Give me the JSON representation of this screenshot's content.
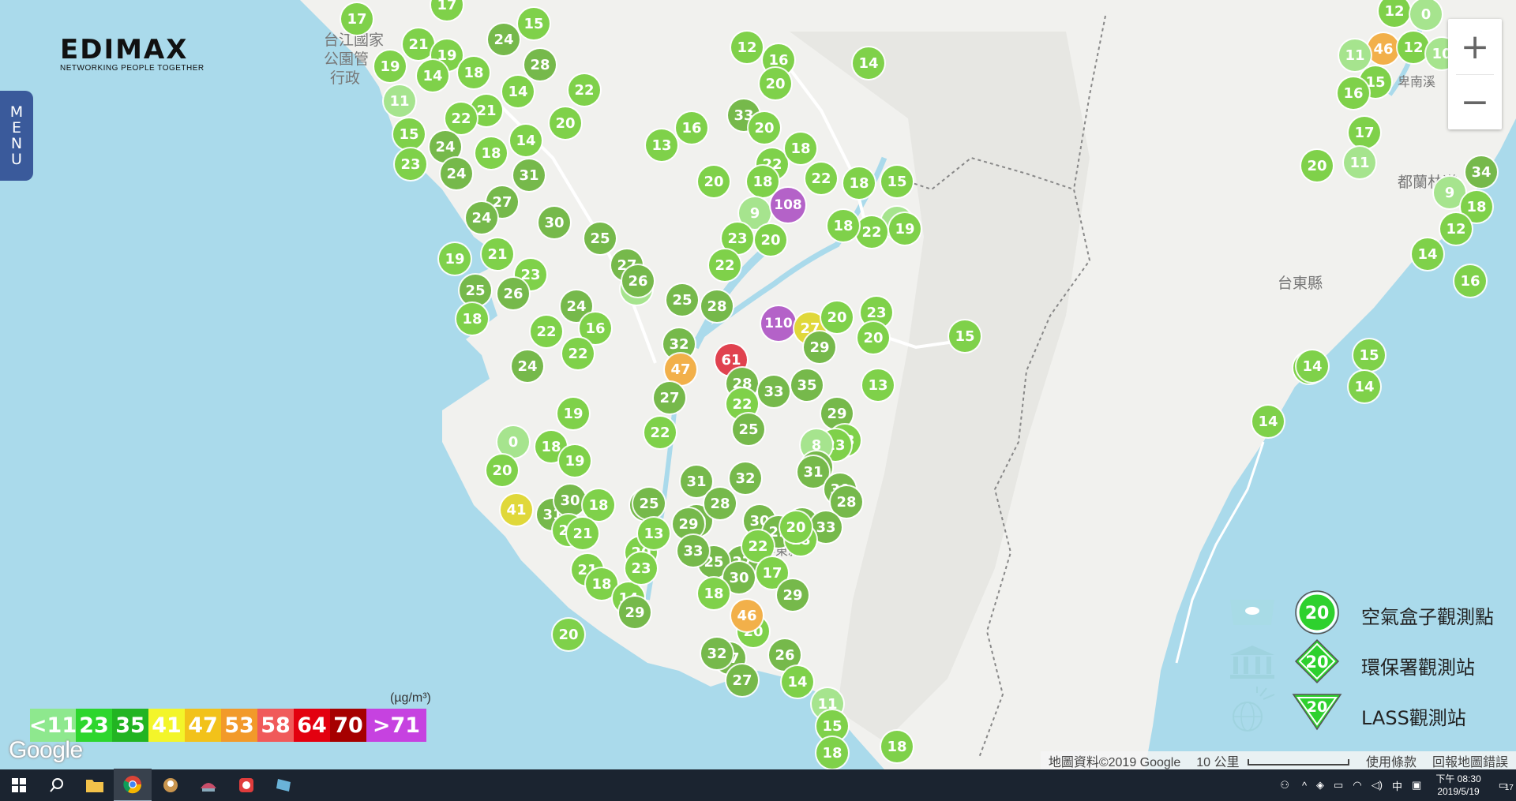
{
  "brand": {
    "logo_text": "EDIMAX",
    "tagline": "NETWORKING PEOPLE TOGETHER"
  },
  "menu_label": [
    "M",
    "E",
    "N",
    "U"
  ],
  "zoom": {
    "in_label": "+",
    "out_label": "−"
  },
  "legend_scale": {
    "unit": "(µg/m³)",
    "cells": [
      {
        "label": "<11",
        "color": "#8ee88e"
      },
      {
        "label": "23",
        "color": "#2dd62d"
      },
      {
        "label": "35",
        "color": "#22b422"
      },
      {
        "label": "41",
        "color": "#f3f52a"
      },
      {
        "label": "47",
        "color": "#f2c21a"
      },
      {
        "label": "53",
        "color": "#f29a2a"
      },
      {
        "label": "58",
        "color": "#f05a5a"
      },
      {
        "label": "64",
        "color": "#e3000f"
      },
      {
        "label": "70",
        "color": "#a60000"
      },
      {
        "label": ">71",
        "color": "#c642e0"
      }
    ]
  },
  "station_legend": [
    {
      "label": "空氣盒子觀測點",
      "value": "20",
      "shape": "circle",
      "icon": "cloud-box-icon"
    },
    {
      "label": "環保署觀測站",
      "value": "20",
      "shape": "diamond",
      "icon": "government-building-icon"
    },
    {
      "label": "LASS觀測站",
      "value": "20",
      "shape": "triangle",
      "icon": "globe-icon"
    }
  ],
  "places": [
    {
      "text": "台江國家"
    },
    {
      "text": "公園管"
    },
    {
      "text": "行政"
    },
    {
      "text": "台東縣"
    },
    {
      "text": "都蘭林道"
    },
    {
      "text": "卑南溪"
    },
    {
      "text": "屏東縣"
    }
  ],
  "attribution": {
    "data": "地圖資料©2019 Google",
    "scale": "10 公里",
    "terms": "使用條款",
    "report": "回報地圖錯誤"
  },
  "google_logo": "Google",
  "taskbar": {
    "time": "下午 08:30",
    "date": "2019/5/19",
    "ime": "中",
    "notification_count": "17"
  },
  "colors": {
    "level_low": "#8ee88e",
    "level_green": "#7fd14a",
    "level_dark": "#76b94b",
    "level_orange": "#f2b04a",
    "level_yellow": "#e0d83a",
    "level_red": "#e0424f",
    "level_purple": "#b462c8"
  },
  "markers": [
    {
      "value": "17",
      "level": "green"
    },
    {
      "value": "17",
      "level": "green"
    },
    {
      "value": "21",
      "level": "green"
    },
    {
      "value": "19",
      "level": "green"
    },
    {
      "value": "24",
      "level": "dark"
    },
    {
      "value": "15",
      "level": "green"
    },
    {
      "value": "19",
      "level": "green"
    },
    {
      "value": "14",
      "level": "green"
    },
    {
      "value": "18",
      "level": "green"
    },
    {
      "value": "28",
      "level": "dark"
    },
    {
      "value": "11",
      "level": "low"
    },
    {
      "value": "14",
      "level": "green"
    },
    {
      "value": "22",
      "level": "green"
    },
    {
      "value": "21",
      "level": "green"
    },
    {
      "value": "15",
      "level": "green"
    },
    {
      "value": "22",
      "level": "green"
    },
    {
      "value": "20",
      "level": "green"
    },
    {
      "value": "24",
      "level": "dark"
    },
    {
      "value": "18",
      "level": "green"
    },
    {
      "value": "14",
      "level": "green"
    },
    {
      "value": "23",
      "level": "green"
    },
    {
      "value": "24",
      "level": "dark"
    },
    {
      "value": "31",
      "level": "dark"
    },
    {
      "value": "27",
      "level": "dark"
    },
    {
      "value": "24",
      "level": "dark"
    },
    {
      "value": "30",
      "level": "dark"
    },
    {
      "value": "19",
      "level": "green"
    },
    {
      "value": "21",
      "level": "green"
    },
    {
      "value": "23",
      "level": "green"
    },
    {
      "value": "25",
      "level": "dark"
    },
    {
      "value": "26",
      "level": "dark"
    },
    {
      "value": "18",
      "level": "green"
    },
    {
      "value": "22",
      "level": "green"
    },
    {
      "value": "24",
      "level": "dark"
    },
    {
      "value": "16",
      "level": "green"
    },
    {
      "value": "22",
      "level": "green"
    },
    {
      "value": "24",
      "level": "dark"
    },
    {
      "value": "19",
      "level": "green"
    },
    {
      "value": "0",
      "level": "low"
    },
    {
      "value": "18",
      "level": "green"
    },
    {
      "value": "19",
      "level": "green"
    },
    {
      "value": "20",
      "level": "green"
    },
    {
      "value": "41",
      "level": "yellow"
    },
    {
      "value": "31",
      "level": "dark"
    },
    {
      "value": "30",
      "level": "dark"
    },
    {
      "value": "18",
      "level": "green"
    },
    {
      "value": "20",
      "level": "green"
    },
    {
      "value": "21",
      "level": "green"
    },
    {
      "value": "21",
      "level": "green"
    },
    {
      "value": "18",
      "level": "green"
    },
    {
      "value": "14",
      "level": "green"
    },
    {
      "value": "25",
      "level": "dark"
    },
    {
      "value": "20",
      "level": "green"
    },
    {
      "value": "9",
      "level": "low"
    },
    {
      "value": "27",
      "level": "dark"
    },
    {
      "value": "25",
      "level": "dark"
    },
    {
      "value": "26",
      "level": "dark"
    },
    {
      "value": "32",
      "level": "dark"
    },
    {
      "value": "47",
      "level": "orange"
    },
    {
      "value": "27",
      "level": "dark"
    },
    {
      "value": "22",
      "level": "green"
    },
    {
      "value": "25",
      "level": "dark"
    },
    {
      "value": "13",
      "level": "green"
    },
    {
      "value": "23",
      "level": "green"
    },
    {
      "value": "29",
      "level": "dark"
    },
    {
      "value": "20",
      "level": "green"
    },
    {
      "value": "12",
      "level": "green"
    },
    {
      "value": "16",
      "level": "green"
    },
    {
      "value": "20",
      "level": "green"
    },
    {
      "value": "33",
      "level": "dark"
    },
    {
      "value": "20",
      "level": "green"
    },
    {
      "value": "16",
      "level": "green"
    },
    {
      "value": "13",
      "level": "green"
    },
    {
      "value": "22",
      "level": "green"
    },
    {
      "value": "18",
      "level": "green"
    },
    {
      "value": "20",
      "level": "green"
    },
    {
      "value": "18",
      "level": "green"
    },
    {
      "value": "9",
      "level": "low"
    },
    {
      "value": "108",
      "level": "purple"
    },
    {
      "value": "22",
      "level": "green"
    },
    {
      "value": "20",
      "level": "green"
    },
    {
      "value": "23",
      "level": "green"
    },
    {
      "value": "22",
      "level": "green"
    },
    {
      "value": "25",
      "level": "dark"
    },
    {
      "value": "28",
      "level": "dark"
    },
    {
      "value": "110",
      "level": "purple"
    },
    {
      "value": "27",
      "level": "yellow"
    },
    {
      "value": "29",
      "level": "dark"
    },
    {
      "value": "61",
      "level": "red"
    },
    {
      "value": "28",
      "level": "dark"
    },
    {
      "value": "33",
      "level": "dark"
    },
    {
      "value": "35",
      "level": "dark"
    },
    {
      "value": "22",
      "level": "green"
    },
    {
      "value": "25",
      "level": "dark"
    },
    {
      "value": "29",
      "level": "dark"
    },
    {
      "value": "23",
      "level": "green"
    },
    {
      "value": "23",
      "level": "green"
    },
    {
      "value": "8",
      "level": "low"
    },
    {
      "value": "31",
      "level": "dark"
    },
    {
      "value": "31",
      "level": "dark"
    },
    {
      "value": "30",
      "level": "dark"
    },
    {
      "value": "28",
      "level": "dark"
    },
    {
      "value": "33",
      "level": "dark"
    },
    {
      "value": "33",
      "level": "dark"
    },
    {
      "value": "32",
      "level": "dark"
    },
    {
      "value": "31",
      "level": "dark"
    },
    {
      "value": "30",
      "level": "dark"
    },
    {
      "value": "28",
      "level": "dark"
    },
    {
      "value": "30",
      "level": "dark"
    },
    {
      "value": "29",
      "level": "dark"
    },
    {
      "value": "27",
      "level": "dark"
    },
    {
      "value": "25",
      "level": "dark"
    },
    {
      "value": "29",
      "level": "dark"
    },
    {
      "value": "22",
      "level": "green"
    },
    {
      "value": "17",
      "level": "green"
    },
    {
      "value": "33",
      "level": "dark"
    },
    {
      "value": "30",
      "level": "dark"
    },
    {
      "value": "29",
      "level": "dark"
    },
    {
      "value": "18",
      "level": "green"
    },
    {
      "value": "20",
      "level": "green"
    },
    {
      "value": "20",
      "level": "green"
    },
    {
      "value": "46",
      "level": "orange"
    },
    {
      "value": "18",
      "level": "green"
    },
    {
      "value": "27",
      "level": "dark"
    },
    {
      "value": "27",
      "level": "dark"
    },
    {
      "value": "32",
      "level": "dark"
    },
    {
      "value": "26",
      "level": "dark"
    },
    {
      "value": "14",
      "level": "green"
    },
    {
      "value": "11",
      "level": "low"
    },
    {
      "value": "15",
      "level": "green"
    },
    {
      "value": "18",
      "level": "green"
    },
    {
      "value": "18",
      "level": "green"
    },
    {
      "value": "15",
      "level": "green"
    },
    {
      "value": "14",
      "level": "green"
    },
    {
      "value": "8",
      "level": "low"
    },
    {
      "value": "22",
      "level": "green"
    },
    {
      "value": "19",
      "level": "green"
    },
    {
      "value": "18",
      "level": "green"
    },
    {
      "value": "18",
      "level": "green"
    },
    {
      "value": "23",
      "level": "green"
    },
    {
      "value": "20",
      "level": "green"
    },
    {
      "value": "15",
      "level": "green"
    },
    {
      "value": "20",
      "level": "green"
    },
    {
      "value": "13",
      "level": "green"
    },
    {
      "value": "12",
      "level": "green"
    },
    {
      "value": "0",
      "level": "low"
    },
    {
      "value": "46",
      "level": "orange"
    },
    {
      "value": "12",
      "level": "green"
    },
    {
      "value": "10",
      "level": "low"
    },
    {
      "value": "11",
      "level": "low"
    },
    {
      "value": "15",
      "level": "green"
    },
    {
      "value": "16",
      "level": "green"
    },
    {
      "value": "17",
      "level": "green"
    },
    {
      "value": "20",
      "level": "green"
    },
    {
      "value": "11",
      "level": "low"
    },
    {
      "value": "9",
      "level": "low"
    },
    {
      "value": "34",
      "level": "dark"
    },
    {
      "value": "18",
      "level": "green"
    },
    {
      "value": "12",
      "level": "green"
    },
    {
      "value": "14",
      "level": "green"
    },
    {
      "value": "16",
      "level": "green"
    },
    {
      "value": "15",
      "level": "green"
    },
    {
      "value": "14",
      "level": "green"
    },
    {
      "value": "15",
      "level": "green"
    },
    {
      "value": "14",
      "level": "green"
    },
    {
      "value": "14",
      "level": "green"
    }
  ]
}
